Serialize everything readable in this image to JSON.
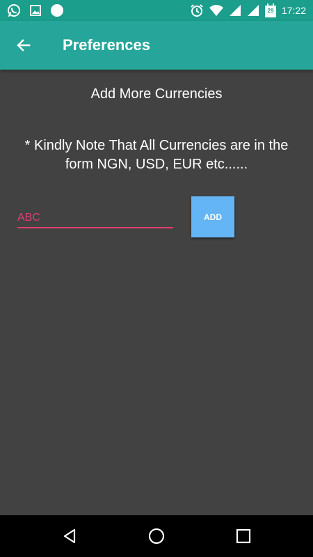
{
  "status_bar": {
    "time": "17:22",
    "calendar_day": "29",
    "icons_left": [
      "whatsapp-icon",
      "image-icon",
      "circle-icon"
    ],
    "icons_right": [
      "alarm-icon",
      "wifi-icon",
      "signal-icon",
      "signal-icon",
      "calendar-icon"
    ]
  },
  "app_bar": {
    "title": "Preferences",
    "back_icon": "arrow-left-icon"
  },
  "main": {
    "heading": "Add More Currencies",
    "note": "* Kindly Note That All Currencies are in the form NGN, USD, EUR etc......",
    "input": {
      "value": "",
      "placeholder": "ABC"
    },
    "add_button_label": "ADD"
  },
  "nav_bar": {
    "icons": [
      "back-triangle-icon",
      "home-circle-icon",
      "recents-square-icon"
    ]
  },
  "colors": {
    "status_bar": "#1b9e8c",
    "app_bar": "#26a69a",
    "background": "#424242",
    "accent": "#e23d6f",
    "button": "#64b5f6"
  }
}
